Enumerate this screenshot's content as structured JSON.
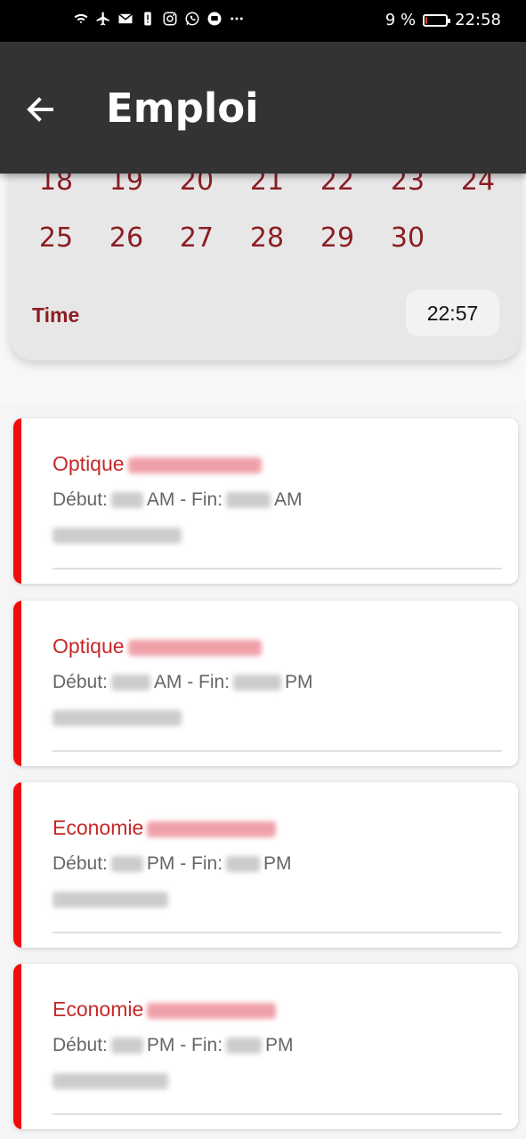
{
  "status_bar": {
    "battery": "9 %",
    "battery_level": 0.09,
    "time": "22:58",
    "icons": [
      "wifi-icon",
      "airplane-icon",
      "mail-icon",
      "alert-icon",
      "instagram-icon",
      "whatsapp-icon",
      "messenger-icon",
      "more-icon"
    ]
  },
  "app_bar": {
    "title": "Emploi"
  },
  "calendar": {
    "week_partial": [
      "18",
      "19",
      "20",
      "21",
      "22",
      "23",
      "24"
    ],
    "week_last": [
      "25",
      "26",
      "27",
      "28",
      "29",
      "30"
    ],
    "time_label": "Time",
    "time_value": "22:57"
  },
  "colors": {
    "accent": "#f20d0d",
    "title_red": "#c62828",
    "calendar_text": "#8b1e22",
    "app_bar": "#333333"
  },
  "classes": [
    {
      "subject": "Optique",
      "debut_label": "Début:",
      "debut_suffix": "AM - Fin:",
      "fin_suffix": "AM"
    },
    {
      "subject": "Optique",
      "debut_label": "Début:",
      "debut_suffix": "AM - Fin:",
      "fin_suffix": "PM"
    },
    {
      "subject": "Economie",
      "debut_label": "Début:",
      "debut_suffix": "PM - Fin:",
      "fin_suffix": "PM"
    },
    {
      "subject": "Economie",
      "debut_label": "Début:",
      "debut_suffix": "PM - Fin:",
      "fin_suffix": "PM"
    }
  ]
}
